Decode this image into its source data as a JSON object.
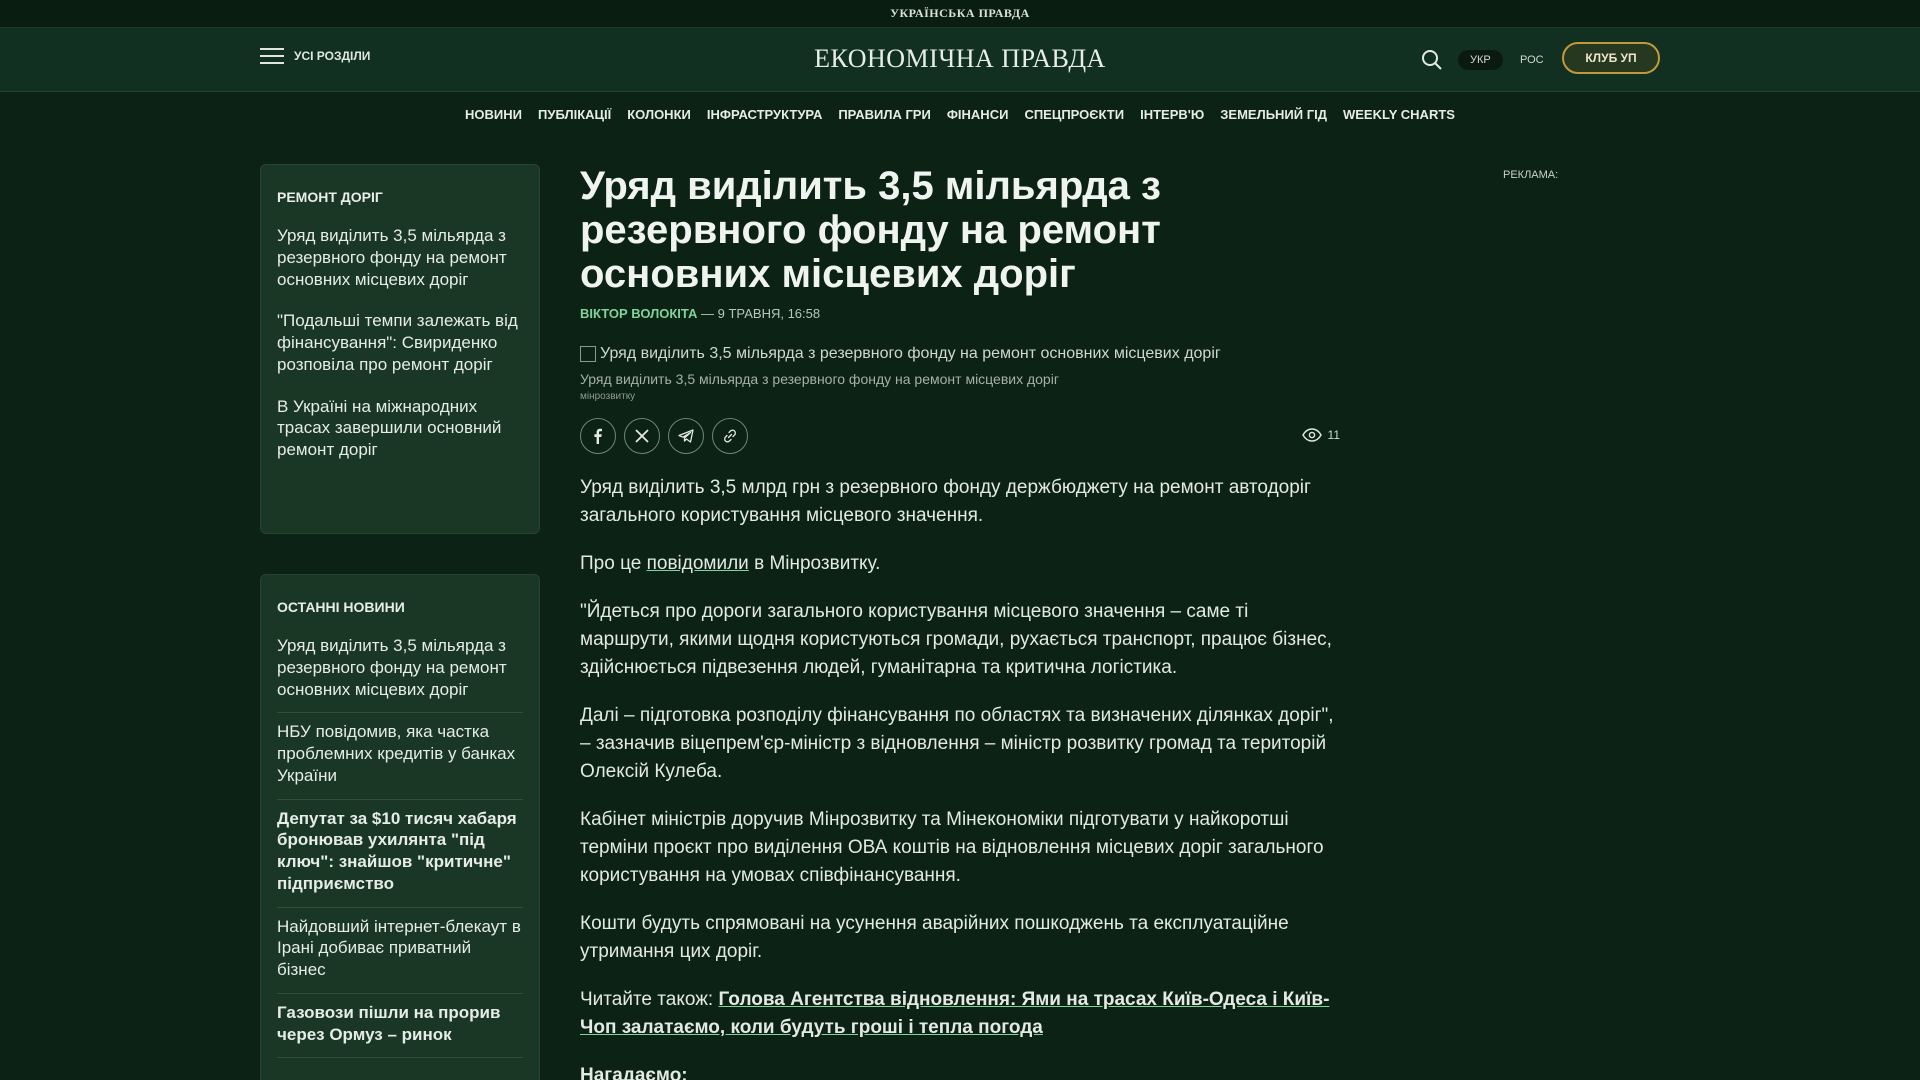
{
  "topbar": {
    "title": "УКРАЇНСЬКА ПРАВДА"
  },
  "header": {
    "menu_label": "УСІ РОЗДІЛИ",
    "logo": "ЕКОНОМІЧНА ПРАВДА",
    "lang_ukr": "УКР",
    "lang_ros": "РОС",
    "club_label": "КЛУБ УП"
  },
  "nav": {
    "items": [
      "НОВИНИ",
      "ПУБЛІКАЦІЇ",
      "КОЛОНКИ",
      "ІНФРАСТРУКТУРА",
      "ПРАВИЛА ГРИ",
      "ФІНАНСИ",
      "СПЕЦПРОЄКТИ",
      "ІНТЕРВ'Ю",
      "ЗЕМЕЛЬНИЙ ГІД",
      "WEEKLY CHARTS"
    ]
  },
  "sidebar_topic": {
    "heading": "РЕМОНТ ДОРІГ",
    "items": [
      "Уряд виділить 3,5 мільярда з резервного фонду на ремонт основних місцевих доріг",
      "\"Подальші темпи залежать від фінансування\": Свириденко розповіла про ремонт доріг",
      "В Україні на міжнародних трасах завершили основний ремонт доріг"
    ]
  },
  "sidebar_latest": {
    "heading": "ОСТАННІ НОВИНИ",
    "items": [
      "Уряд виділить 3,5 мільярда з резервного фонду на ремонт основних місцевих доріг",
      "НБУ повідомив, яка частка проблемних кредитів у банках України",
      "Депутат за $10 тисяч хабаря бронював ухилянта \"під ключ\": знайшов \"критичне\" підприємство",
      "Найдовший інтернет-блекаут в Ірані добиває приватний бізнес",
      "Газовози пішли на прорив через Ормуз – ринок"
    ]
  },
  "article": {
    "title": "Уряд виділить 3,5 мільярда з резервного фонду на ремонт основних місцевих доріг",
    "author": "ВІКТОР ВОЛОКІТА",
    "date": " — 9 ТРАВНЯ, 16:58",
    "image_alt": "Уряд виділить 3,5 мільярда з резервного фонду на ремонт основних місцевих доріг",
    "caption": "Уряд виділить 3,5 мільярда з резервного фонду на ремонт місцевих доріг",
    "credit": "мінрозвитку",
    "views": "11",
    "p1": "Уряд виділить 3,5 млрд грн з резервного фонду держбюджету на ремонт автодоріг загального користування місцевого значення.",
    "p2_before": "Про це ",
    "p2_link": "повідомили",
    "p2_after": " в Мінрозвитку.",
    "p3": "\"Йдеться про дороги загального користування місцевого значення – саме ті маршрути, якими щодня користуються громади, рухається транспорт, працює бізнес, здійснюється підвезення людей, гуманітарна та критична логістика.",
    "p4": "Далі – підготовка розподілу фінансування по областях та визначених ділянках доріг\", – зазначив віцепрем'єр-міністр з відновлення – міністр розвитку громад та територій Олексій Кулеба.",
    "p5": "Кабінет міністрів доручив Мінрозвитку та Мінекономіки підготувати у найкоротші терміни проєкт про виділення ОВА коштів на відновлення місцевих доріг загального користування на умовах співфінансування.",
    "p6": "Кошти будуть спрямовані на усунення аварійних пошкоджень та експлуатаційне утримання цих доріг.",
    "read_also_label": "Читайте також: ",
    "read_also_link": "Голова Агентства відновлення: Ями на трасах Київ-Одеса і Київ-Чоп залатаємо, коли будуть гроші і тепла погода",
    "remind": "Нагадаємо:"
  },
  "ad": {
    "label": "РЕКЛАМА:"
  },
  "icons": {
    "menu": "hamburger-icon",
    "search": "search-icon",
    "share_facebook": "facebook-icon",
    "share_x": "x-icon",
    "share_telegram": "telegram-icon",
    "share_link": "link-icon",
    "views": "eye-icon",
    "image": "broken-image-icon"
  }
}
